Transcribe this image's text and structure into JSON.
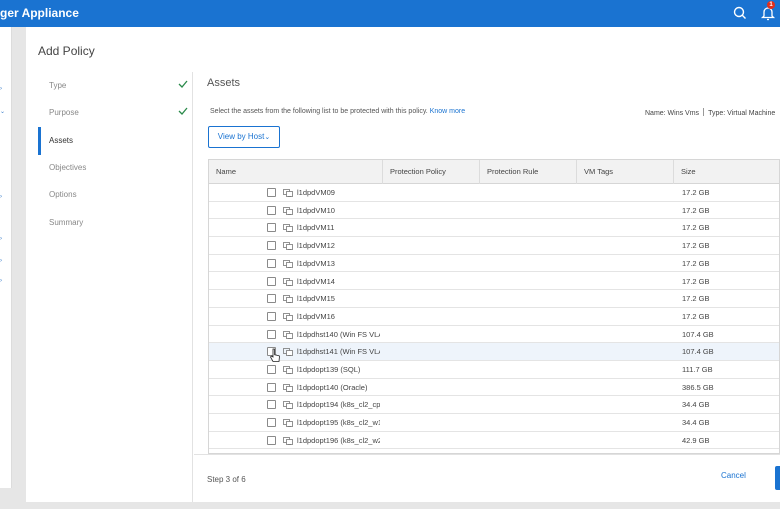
{
  "app": {
    "title": "ger Appliance"
  },
  "topbar": {
    "notification_count": "1"
  },
  "dialog": {
    "title": "Add Policy"
  },
  "steps": [
    {
      "label": "Type",
      "done": true
    },
    {
      "label": "Purpose",
      "done": true
    },
    {
      "label": "Assets",
      "done": false,
      "active": true
    },
    {
      "label": "Objectives",
      "done": false
    },
    {
      "label": "Options",
      "done": false
    },
    {
      "label": "Summary",
      "done": false
    }
  ],
  "assets": {
    "title": "Assets",
    "description": "Select the assets from the following list to be protected with this policy.",
    "know_more": "Know more",
    "meta": {
      "name": "Name: Wins Vms",
      "type": "Type: Virtual Machine"
    },
    "view_button": "View by Host",
    "columns": [
      "Name",
      "Protection Policy",
      "Protection Rule",
      "VM Tags",
      "Size"
    ],
    "rows": [
      {
        "name": "l1dpdVM09",
        "size": "17.2 GB"
      },
      {
        "name": "l1dpdVM10",
        "size": "17.2 GB"
      },
      {
        "name": "l1dpdVM11",
        "size": "17.2 GB"
      },
      {
        "name": "l1dpdVM12",
        "size": "17.2 GB"
      },
      {
        "name": "l1dpdVM13",
        "size": "17.2 GB"
      },
      {
        "name": "l1dpdVM14",
        "size": "17.2 GB"
      },
      {
        "name": "l1dpdVM15",
        "size": "17.2 GB"
      },
      {
        "name": "l1dpdVM16",
        "size": "17.2 GB"
      },
      {
        "name": "l1dpdhst140 (Win FS VLAN",
        "size": "107.4 GB"
      },
      {
        "name": "l1dpdhst141 (Win FS VLAN",
        "size": "107.4 GB",
        "hover": true
      },
      {
        "name": "l1dpdopt139 (SQL)",
        "size": "111.7 GB"
      },
      {
        "name": "l1dpdopt140 (Oracle)",
        "size": "386.5 GB"
      },
      {
        "name": "l1dpdopt194 (k8s_cl2_cp",
        "size": "34.4 GB"
      },
      {
        "name": "l1dpdopt195 (k8s_cl2_w1",
        "size": "34.4 GB"
      },
      {
        "name": "l1dpdopt196 (k8s_cl2_w2",
        "size": "42.9 GB"
      }
    ]
  },
  "footer": {
    "step_count": "Step 3 of 6",
    "cancel": "Cancel"
  },
  "colors": {
    "accent": "#1a73d1",
    "topbar": "#1a73d1"
  },
  "icons": {
    "search": "search-icon",
    "bell": "bell-icon",
    "check": "check-icon",
    "vm": "vm-icon",
    "chevron": "chevron-down-icon"
  }
}
